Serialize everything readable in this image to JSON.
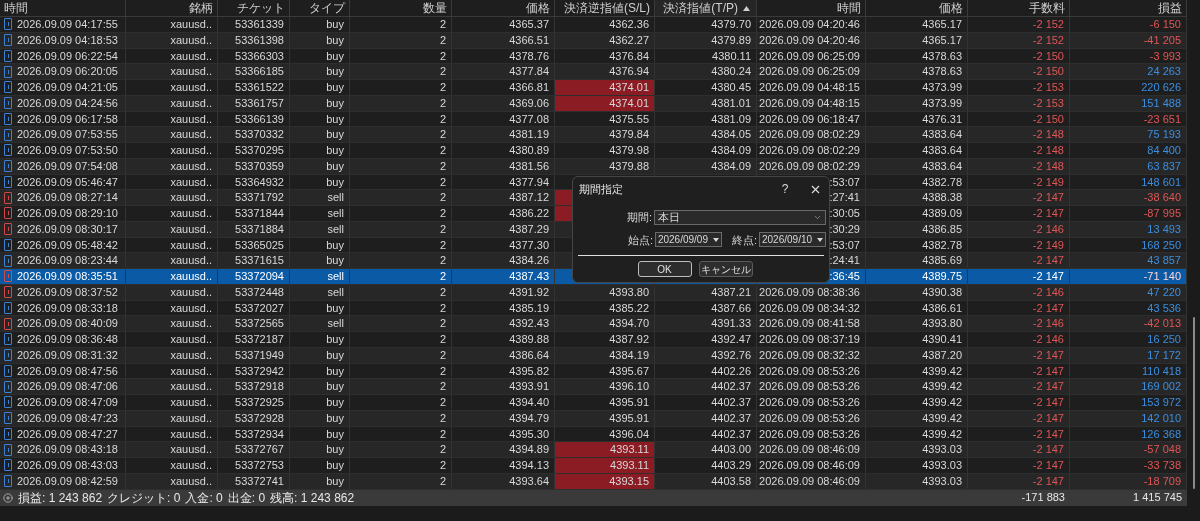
{
  "table": {
    "columns": [
      {
        "label": "時間",
        "sorted": false
      },
      {
        "label": "銘柄",
        "sorted": false
      },
      {
        "label": "チケット",
        "sorted": false
      },
      {
        "label": "タイプ",
        "sorted": false
      },
      {
        "label": "数量",
        "sorted": false
      },
      {
        "label": "価格",
        "sorted": false
      },
      {
        "label": "決済逆指値(S/L)",
        "sorted": false
      },
      {
        "label": "決済指値(T/P)",
        "sorted": true
      },
      {
        "label": "時間",
        "sorted": false
      },
      {
        "label": "価格",
        "sorted": false
      },
      {
        "label": "手数料",
        "sorted": false
      },
      {
        "label": "損益",
        "sorted": false
      }
    ],
    "rows": [
      {
        "kind": "buy",
        "selected": false,
        "sl_hit": false,
        "loss": true,
        "cells": [
          "2026.09.09 04:17:55",
          "xauusd..",
          "53361339",
          "buy",
          "2",
          "4365.37",
          "4362.36",
          "4379.70",
          "2026.09.09 04:20:46",
          "4365.17",
          "-2 152",
          "-6 150"
        ]
      },
      {
        "kind": "buy",
        "selected": false,
        "sl_hit": false,
        "loss": true,
        "cells": [
          "2026.09.09 04:18:53",
          "xauusd..",
          "53361398",
          "buy",
          "2",
          "4366.51",
          "4362.27",
          "4379.89",
          "2026.09.09 04:20:46",
          "4365.17",
          "-2 152",
          "-41 205"
        ]
      },
      {
        "kind": "buy",
        "selected": false,
        "sl_hit": false,
        "loss": true,
        "cells": [
          "2026.09.09 06:22:54",
          "xauusd..",
          "53366303",
          "buy",
          "2",
          "4378.76",
          "4376.84",
          "4380.11",
          "2026.09.09 06:25:09",
          "4378.63",
          "-2 150",
          "-3 993"
        ]
      },
      {
        "kind": "buy",
        "selected": false,
        "sl_hit": false,
        "loss": false,
        "cells": [
          "2026.09.09 06:20:05",
          "xauusd..",
          "53366185",
          "buy",
          "2",
          "4377.84",
          "4376.94",
          "4380.24",
          "2026.09.09 06:25:09",
          "4378.63",
          "-2 150",
          "24 263"
        ]
      },
      {
        "kind": "buy",
        "selected": false,
        "sl_hit": true,
        "loss": false,
        "cells": [
          "2026.09.09 04:21:05",
          "xauusd..",
          "53361522",
          "buy",
          "2",
          "4366.81",
          "4374.01",
          "4380.45",
          "2026.09.09 04:48:15",
          "4373.99",
          "-2 153",
          "220 626"
        ]
      },
      {
        "kind": "buy",
        "selected": false,
        "sl_hit": true,
        "loss": false,
        "cells": [
          "2026.09.09 04:24:56",
          "xauusd..",
          "53361757",
          "buy",
          "2",
          "4369.06",
          "4374.01",
          "4381.01",
          "2026.09.09 04:48:15",
          "4373.99",
          "-2 153",
          "151 488"
        ]
      },
      {
        "kind": "buy",
        "selected": false,
        "sl_hit": false,
        "loss": true,
        "cells": [
          "2026.09.09 06:17:58",
          "xauusd..",
          "53366139",
          "buy",
          "2",
          "4377.08",
          "4375.55",
          "4381.09",
          "2026.09.09 06:18:47",
          "4376.31",
          "-2 150",
          "-23 651"
        ]
      },
      {
        "kind": "buy",
        "selected": false,
        "sl_hit": false,
        "loss": false,
        "cells": [
          "2026.09.09 07:53:55",
          "xauusd..",
          "53370332",
          "buy",
          "2",
          "4381.19",
          "4379.84",
          "4384.05",
          "2026.09.09 08:02:29",
          "4383.64",
          "-2 148",
          "75 193"
        ]
      },
      {
        "kind": "buy",
        "selected": false,
        "sl_hit": false,
        "loss": false,
        "cells": [
          "2026.09.09 07:53:50",
          "xauusd..",
          "53370295",
          "buy",
          "2",
          "4380.89",
          "4379.98",
          "4384.09",
          "2026.09.09 08:02:29",
          "4383.64",
          "-2 148",
          "84 400"
        ]
      },
      {
        "kind": "buy",
        "selected": false,
        "sl_hit": false,
        "loss": false,
        "cells": [
          "2026.09.09 07:54:08",
          "xauusd..",
          "53370359",
          "buy",
          "2",
          "4381.56",
          "4379.88",
          "4384.09",
          "2026.09.09 08:02:29",
          "4383.64",
          "-2 148",
          "63 837"
        ]
      },
      {
        "kind": "buy",
        "selected": false,
        "sl_hit": false,
        "loss": false,
        "cells": [
          "2026.09.09 05:46:47",
          "xauusd..",
          "53364932",
          "buy",
          "2",
          "4377.94",
          null,
          null,
          ":53:07",
          "4382.78",
          "-2 149",
          "148 601"
        ]
      },
      {
        "kind": "sell",
        "selected": false,
        "sl_hit": true,
        "loss": true,
        "cells": [
          "2026.09.09 08:27:14",
          "xauusd..",
          "53371792",
          "sell",
          "2",
          "4387.12",
          null,
          null,
          ":27:41",
          "4388.38",
          "-2 147",
          "-38 640"
        ]
      },
      {
        "kind": "sell",
        "selected": false,
        "sl_hit": true,
        "loss": true,
        "cells": [
          "2026.09.09 08:29:10",
          "xauusd..",
          "53371844",
          "sell",
          "2",
          "4386.22",
          null,
          null,
          ":30:05",
          "4389.09",
          "-2 147",
          "-87 995"
        ]
      },
      {
        "kind": "sell",
        "selected": false,
        "sl_hit": false,
        "loss": false,
        "cells": [
          "2026.09.09 08:30:17",
          "xauusd..",
          "53371884",
          "sell",
          "2",
          "4387.29",
          null,
          null,
          ":30:29",
          "4386.85",
          "-2 146",
          "13 493"
        ]
      },
      {
        "kind": "buy",
        "selected": false,
        "sl_hit": false,
        "loss": false,
        "cells": [
          "2026.09.09 05:48:42",
          "xauusd..",
          "53365025",
          "buy",
          "2",
          "4377.30",
          null,
          null,
          ":53:07",
          "4382.78",
          "-2 149",
          "168 250"
        ]
      },
      {
        "kind": "buy",
        "selected": false,
        "sl_hit": false,
        "loss": false,
        "cells": [
          "2026.09.09 08:23:44",
          "xauusd..",
          "53371615",
          "buy",
          "2",
          "4384.26",
          null,
          null,
          ":24:41",
          "4385.69",
          "-2 147",
          "43 857"
        ]
      },
      {
        "kind": "sell",
        "selected": true,
        "sl_hit": false,
        "loss": true,
        "cells": [
          "2026.09.09 08:35:51",
          "xauusd..",
          "53372094",
          "sell",
          "2",
          "4387.43",
          null,
          null,
          ":36:45",
          "4389.75",
          "-2 147",
          "-71 140"
        ]
      },
      {
        "kind": "sell",
        "selected": false,
        "sl_hit": false,
        "loss": false,
        "cells": [
          "2026.09.09 08:37:52",
          "xauusd..",
          "53372448",
          "sell",
          "2",
          "4391.92",
          "4393.80",
          "4387.21",
          "2026.09.09 08:38:36",
          "4390.38",
          "-2 146",
          "47 220"
        ]
      },
      {
        "kind": "buy",
        "selected": false,
        "sl_hit": false,
        "loss": false,
        "cells": [
          "2026.09.09 08:33:18",
          "xauusd..",
          "53372027",
          "buy",
          "2",
          "4385.19",
          "4385.22",
          "4387.66",
          "2026.09.09 08:34:32",
          "4386.61",
          "-2 147",
          "43 536"
        ]
      },
      {
        "kind": "sell",
        "selected": false,
        "sl_hit": false,
        "loss": true,
        "cells": [
          "2026.09.09 08:40:09",
          "xauusd..",
          "53372565",
          "sell",
          "2",
          "4392.43",
          "4394.70",
          "4391.33",
          "2026.09.09 08:41:58",
          "4393.80",
          "-2 146",
          "-42 013"
        ]
      },
      {
        "kind": "buy",
        "selected": false,
        "sl_hit": false,
        "loss": false,
        "cells": [
          "2026.09.09 08:36:48",
          "xauusd..",
          "53372187",
          "buy",
          "2",
          "4389.88",
          "4387.92",
          "4392.47",
          "2026.09.09 08:37:19",
          "4390.41",
          "-2 146",
          "16 250"
        ]
      },
      {
        "kind": "buy",
        "selected": false,
        "sl_hit": false,
        "loss": false,
        "cells": [
          "2026.09.09 08:31:32",
          "xauusd..",
          "53371949",
          "buy",
          "2",
          "4386.64",
          "4384.19",
          "4392.76",
          "2026.09.09 08:32:32",
          "4387.20",
          "-2 147",
          "17 172"
        ]
      },
      {
        "kind": "buy",
        "selected": false,
        "sl_hit": false,
        "loss": false,
        "cells": [
          "2026.09.09 08:47:56",
          "xauusd..",
          "53372942",
          "buy",
          "2",
          "4395.82",
          "4395.67",
          "4402.26",
          "2026.09.09 08:53:26",
          "4399.42",
          "-2 147",
          "110 418"
        ]
      },
      {
        "kind": "buy",
        "selected": false,
        "sl_hit": false,
        "loss": false,
        "cells": [
          "2026.09.09 08:47:06",
          "xauusd..",
          "53372918",
          "buy",
          "2",
          "4393.91",
          "4396.10",
          "4402.37",
          "2026.09.09 08:53:26",
          "4399.42",
          "-2 147",
          "169 002"
        ]
      },
      {
        "kind": "buy",
        "selected": false,
        "sl_hit": false,
        "loss": false,
        "cells": [
          "2026.09.09 08:47:09",
          "xauusd..",
          "53372925",
          "buy",
          "2",
          "4394.40",
          "4395.91",
          "4402.37",
          "2026.09.09 08:53:26",
          "4399.42",
          "-2 147",
          "153 972"
        ]
      },
      {
        "kind": "buy",
        "selected": false,
        "sl_hit": false,
        "loss": false,
        "cells": [
          "2026.09.09 08:47:23",
          "xauusd..",
          "53372928",
          "buy",
          "2",
          "4394.79",
          "4395.91",
          "4402.37",
          "2026.09.09 08:53:26",
          "4399.42",
          "-2 147",
          "142 010"
        ]
      },
      {
        "kind": "buy",
        "selected": false,
        "sl_hit": false,
        "loss": false,
        "cells": [
          "2026.09.09 08:47:27",
          "xauusd..",
          "53372934",
          "buy",
          "2",
          "4395.30",
          "4396.04",
          "4402.37",
          "2026.09.09 08:53:26",
          "4399.42",
          "-2 147",
          "126 368"
        ]
      },
      {
        "kind": "buy",
        "selected": false,
        "sl_hit": true,
        "loss": true,
        "cells": [
          "2026.09.09 08:43:18",
          "xauusd..",
          "53372767",
          "buy",
          "2",
          "4394.89",
          "4393.11",
          "4403.00",
          "2026.09.09 08:46:09",
          "4393.03",
          "-2 147",
          "-57 048"
        ]
      },
      {
        "kind": "buy",
        "selected": false,
        "sl_hit": true,
        "loss": true,
        "cells": [
          "2026.09.09 08:43:03",
          "xauusd..",
          "53372753",
          "buy",
          "2",
          "4394.13",
          "4393.11",
          "4403.29",
          "2026.09.09 08:46:09",
          "4393.03",
          "-2 147",
          "-33 738"
        ]
      },
      {
        "kind": "buy",
        "selected": false,
        "sl_hit": true,
        "loss": true,
        "cells": [
          "2026.09.09 08:42:59",
          "xauusd..",
          "53372741",
          "buy",
          "2",
          "4393.64",
          "4393.15",
          "4403.58",
          "2026.09.09 08:46:09",
          "4393.03",
          "-2 147",
          "-18 709"
        ]
      }
    ]
  },
  "summary": {
    "items": [
      "損益: 1 243 862",
      "クレジット: 0",
      "入金: 0",
      "出金: 0",
      "残高: 1 243 862"
    ],
    "total_commission": "-171 883",
    "total_profit": "1 415 745"
  },
  "dialog": {
    "title": "期間指定",
    "help": "?",
    "period": {
      "label": "期間:",
      "value": "本日"
    },
    "start": {
      "label": "始点:",
      "value": "2026/09/09"
    },
    "end": {
      "label": "終点:",
      "value": "2026/09/10"
    },
    "buttons": [
      {
        "label": "OK",
        "focused": true
      },
      {
        "label": "キャンセル",
        "focused": false
      }
    ]
  }
}
